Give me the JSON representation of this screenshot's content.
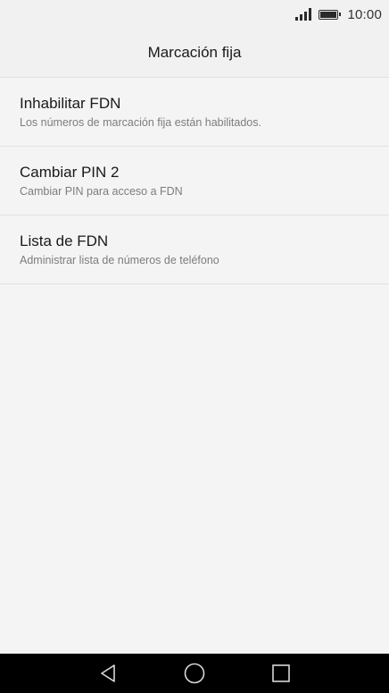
{
  "status_bar": {
    "time": "10:00",
    "icons": [
      "signal-icon",
      "battery-icon"
    ]
  },
  "header": {
    "title": "Marcación fija"
  },
  "list": {
    "items": [
      {
        "title": "Inhabilitar FDN",
        "subtitle": "Los números de marcación fija están habilitados."
      },
      {
        "title": "Cambiar PIN 2",
        "subtitle": "Cambiar PIN para acceso a FDN"
      },
      {
        "title": "Lista de FDN",
        "subtitle": "Administrar lista de números de teléfono"
      }
    ]
  },
  "nav_bar": {
    "icons": [
      "back-icon",
      "home-icon",
      "recents-icon"
    ]
  },
  "colors": {
    "background": "#f4f4f4",
    "bar_background": "#f1f1f1",
    "nav_background": "#000000",
    "primary_text": "#1a1a1a",
    "secondary_text": "#7d7d7d",
    "divider": "#e2e2e2"
  }
}
